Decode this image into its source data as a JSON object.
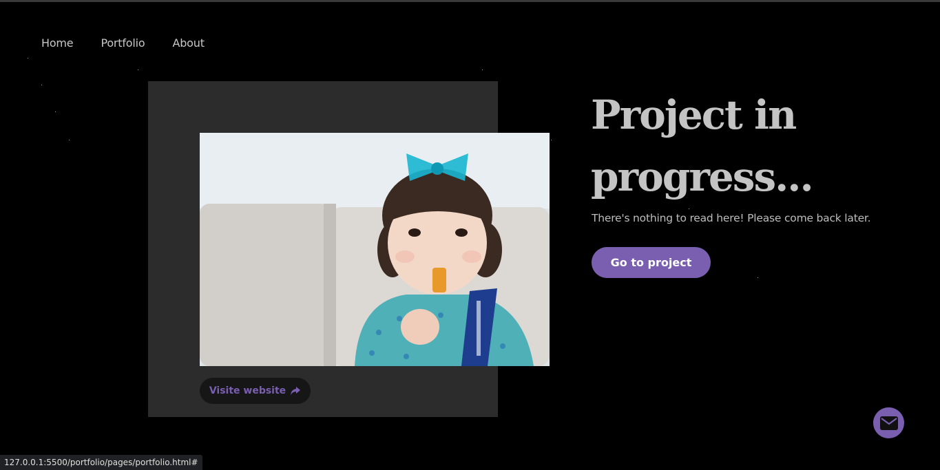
{
  "nav": {
    "items": [
      {
        "label": "Home"
      },
      {
        "label": "Portfolio"
      },
      {
        "label": "About"
      }
    ]
  },
  "project": {
    "visit_label": "Visite website",
    "headline": "Project in progress...",
    "description": "There's nothing to read here! Please come back later.",
    "go_label": "Go to project"
  },
  "status_bar": {
    "url": "127.0.0.1:5500/portfolio/pages/portfolio.html#"
  },
  "colors": {
    "accent": "#7a5fb0",
    "background": "#000000",
    "card": "#2c2c2c"
  },
  "icons": {
    "visit": "share-arrow-icon",
    "contact": "mail-icon"
  }
}
